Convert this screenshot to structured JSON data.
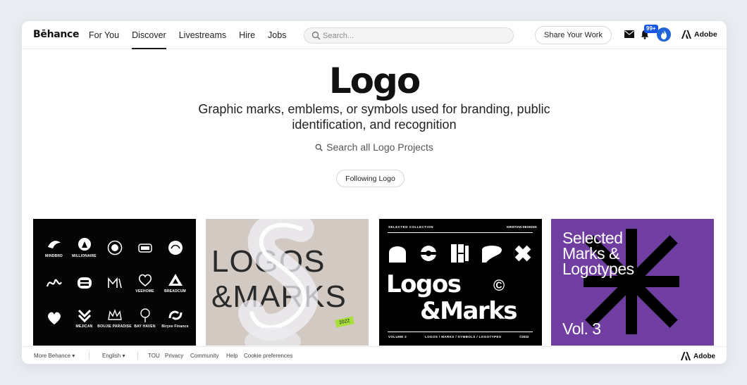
{
  "header": {
    "brand": "Bēhance",
    "nav": [
      "For You",
      "Discover",
      "Livestreams",
      "Hire",
      "Jobs"
    ],
    "active_nav": "Discover",
    "search_placeholder": "Search...",
    "share_button": "Share Your Work",
    "notification_badge": "99+",
    "adobe_label": "Adobe",
    "icons": [
      "search-icon",
      "mail-icon",
      "bell-icon",
      "avatar-flame-icon",
      "adobe-logo-icon"
    ]
  },
  "hero": {
    "title": "Logo",
    "description": "Graphic marks, emblems, or symbols used for branding, public identification, and recognition",
    "search_label": "Search all Logo Projects",
    "follow_button": "Following Logo"
  },
  "cards": [
    {
      "type": "logo-collection",
      "captions": [
        "MINDBRD",
        "MILLIONAIRE",
        "",
        "",
        "",
        "",
        "",
        "",
        "",
        "",
        "",
        "MEJICAN",
        "BOUJIE PARADISE",
        "BAY HAVEN",
        "Biryee Finance"
      ],
      "row2_captions": [
        "",
        "",
        "",
        "VEEHOME",
        "BREADCUM"
      ]
    },
    {
      "type": "cover",
      "line1": "LOGOS",
      "line2": "&MARKS",
      "year": "2022"
    },
    {
      "type": "cover",
      "header_left": "SELECTED COLLECTION",
      "header_right": "KRISTIAN DESIGNS",
      "line1": "Logos",
      "line2": "&Marks",
      "copyright": "©",
      "footer_left": "VOLUME 2",
      "footer_mid": "LOGOS / MARKS / SYMBOLS / LOGOTYPES",
      "footer_right": "©2022"
    },
    {
      "type": "cover",
      "title_lines": [
        "Selected",
        "Marks &",
        "Logotypes"
      ],
      "volume": "Vol. 3",
      "colors": {
        "background": "#6f3ea0",
        "mark": "#000000"
      }
    }
  ],
  "footer": {
    "more": "More Behance ▾",
    "language": "English ▾",
    "links": [
      "TOU",
      "Privacy",
      "Community",
      "Help",
      "Cookie preferences"
    ],
    "adobe_label": "Adobe"
  },
  "colors": {
    "accent": "#1658e5",
    "page_bg": "#e9edf2"
  }
}
